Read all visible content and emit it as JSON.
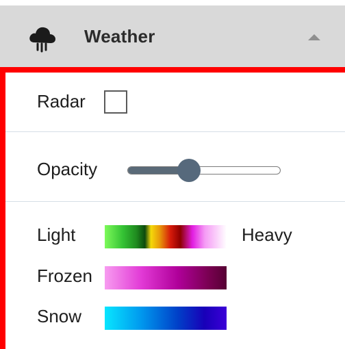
{
  "header": {
    "title": "Weather",
    "icon": "cloud-rain-icon",
    "collapse_icon": "chevron-up-icon"
  },
  "radar": {
    "label": "Radar",
    "checked": false
  },
  "opacity": {
    "label": "Opacity",
    "value": 0.4
  },
  "legend": {
    "light_label": "Light",
    "heavy_label": "Heavy",
    "frozen_label": "Frozen",
    "snow_label": "Snow"
  },
  "colors": {
    "panel_border": "#ff0000",
    "header_bg": "#d9d9d9",
    "slider_thumb": "#56697c"
  }
}
